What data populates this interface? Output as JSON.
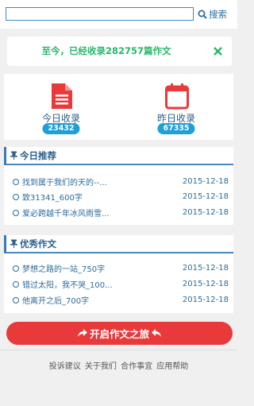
{
  "search": {
    "placeholder": "",
    "button_label": "搜索"
  },
  "notice": {
    "text": "至今，已经收录282757篇作文"
  },
  "stats": {
    "today": {
      "label": "今日收录",
      "count": "23432"
    },
    "yesterday": {
      "label": "昨日收录",
      "count": "67335"
    }
  },
  "recommended": {
    "heading": "今日推荐",
    "items": [
      {
        "title": "找到属于我们的天的--...",
        "date": "2015-12-18"
      },
      {
        "title": "致31341_600字",
        "date": "2015-12-18"
      },
      {
        "title": "爱必跨越千年冰风雨雪...",
        "date": "2015-12-18"
      }
    ]
  },
  "excellent": {
    "heading": "优秀作文",
    "items": [
      {
        "title": "梦想之路的一站_750字",
        "date": "2015-12-18"
      },
      {
        "title": "错过太阳，我不哭_100...",
        "date": "2015-12-18"
      },
      {
        "title": "他离开之后_700字",
        "date": "2015-12-18"
      }
    ]
  },
  "start_button": {
    "label": "开启作文之旅"
  },
  "footer": {
    "links": [
      "投诉建议",
      "关于我们",
      "合作事宜",
      "应用帮助"
    ]
  },
  "colors": {
    "accent_blue": "#1e9fd6",
    "notice_green": "#28b86a",
    "start_red": "#e8393b",
    "icon_red": "#e8393b"
  }
}
